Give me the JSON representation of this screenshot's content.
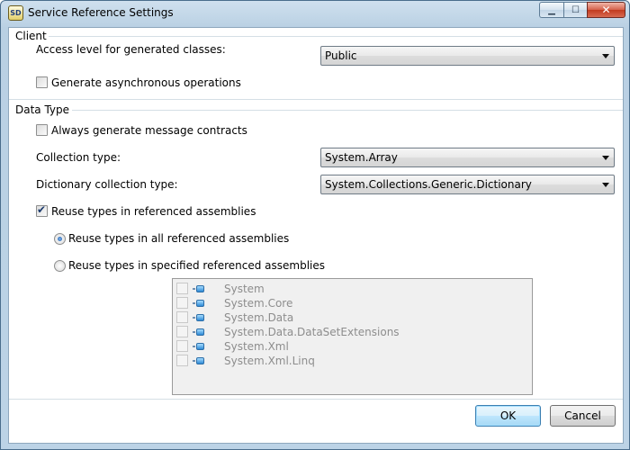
{
  "window": {
    "title": "Service Reference Settings",
    "icon_name": "svcutil-app-icon",
    "buttons": [
      "minimize-icon",
      "maximize-icon",
      "close-icon"
    ]
  },
  "client": {
    "group_label": "Client",
    "access_level_label": "Access level for generated classes:",
    "access_level_value": "Public",
    "async_label": "Generate asynchronous operations",
    "async_checked": false
  },
  "data_type": {
    "group_label": "Data Type",
    "message_contracts_label": "Always generate message contracts",
    "message_contracts_checked": false,
    "collection_label": "Collection type:",
    "collection_value": "System.Array",
    "dictionary_label": "Dictionary collection type:",
    "dictionary_value": "System.Collections.Generic.Dictionary",
    "reuse_label": "Reuse types in referenced assemblies",
    "reuse_checked": true,
    "reuse_all_label": "Reuse types in all referenced assemblies",
    "reuse_specified_label": "Reuse types in specified referenced assemblies",
    "selected_option": "all",
    "assemblies": [
      {
        "name": "System",
        "checked": false
      },
      {
        "name": "System.Core",
        "checked": false
      },
      {
        "name": "System.Data",
        "checked": false
      },
      {
        "name": "System.Data.DataSetExtensions",
        "checked": false
      },
      {
        "name": "System.Xml",
        "checked": false
      },
      {
        "name": "System.Xml.Linq",
        "checked": false
      }
    ]
  },
  "footer": {
    "ok_label": "OK",
    "cancel_label": "Cancel"
  },
  "colors": {
    "frame": "#bcd3e6",
    "default_button_border": "#3c7fb1",
    "disabled_text": "#8d8d8d"
  }
}
